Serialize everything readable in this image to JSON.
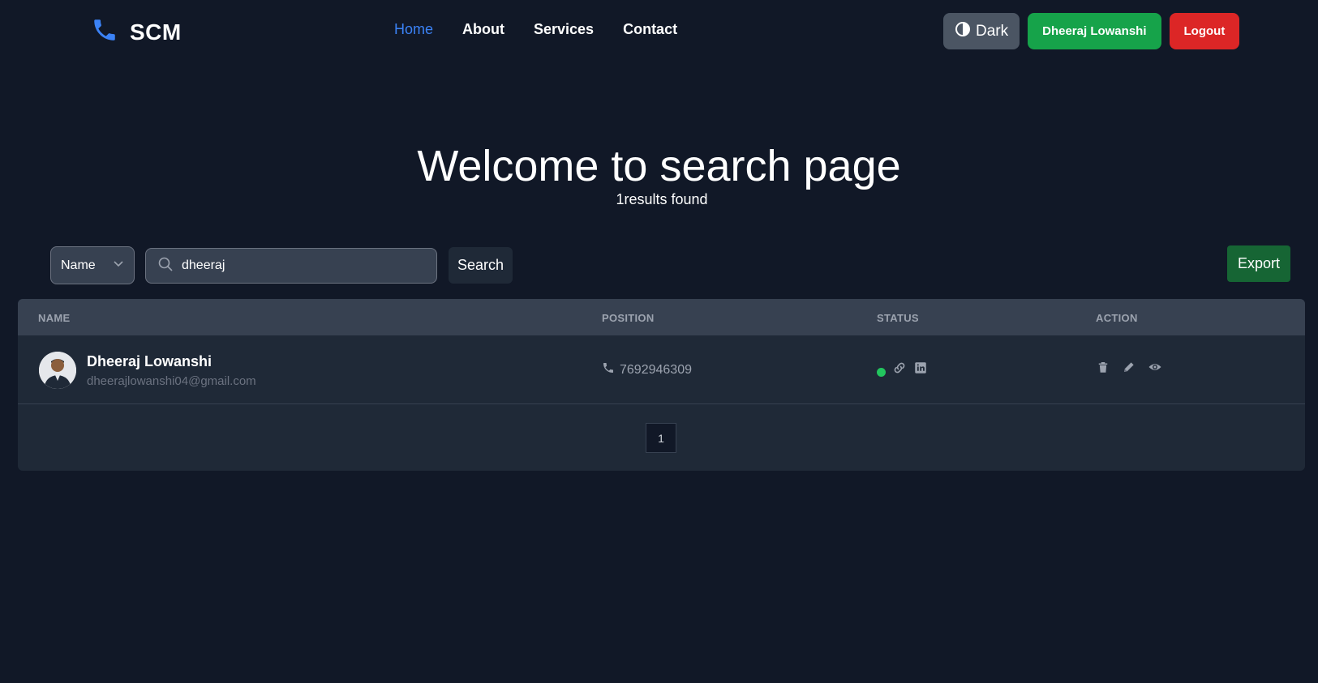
{
  "brand": {
    "name": "SCM",
    "icon": "phone-icon"
  },
  "nav": {
    "links": [
      {
        "label": "Home",
        "active": true
      },
      {
        "label": "About",
        "active": false
      },
      {
        "label": "Services",
        "active": false
      },
      {
        "label": "Contact",
        "active": false
      }
    ],
    "theme_label": "Dark",
    "user_label": "Dheeraj Lowanshi",
    "logout_label": "Logout"
  },
  "hero": {
    "title": "Welcome to search page",
    "results_text": "1results found"
  },
  "search": {
    "field_selected": "Name",
    "query": "dheeraj",
    "button_label": "Search",
    "export_label": "Export"
  },
  "table": {
    "headers": [
      "NAME",
      "POSITION",
      "STATUS",
      "ACTION"
    ],
    "rows": [
      {
        "name": "Dheeraj Lowanshi",
        "email": "dheerajlowanshi04@gmail.com",
        "phone": "7692946309",
        "favorite": true
      }
    ]
  },
  "pagination": {
    "pages": [
      "1"
    ]
  },
  "colors": {
    "background": "#111827",
    "accent": "#3b82f6",
    "user_button": "#16a34a",
    "logout_button": "#dc2626",
    "export_button": "#166534",
    "status_dot": "#22c55e"
  }
}
